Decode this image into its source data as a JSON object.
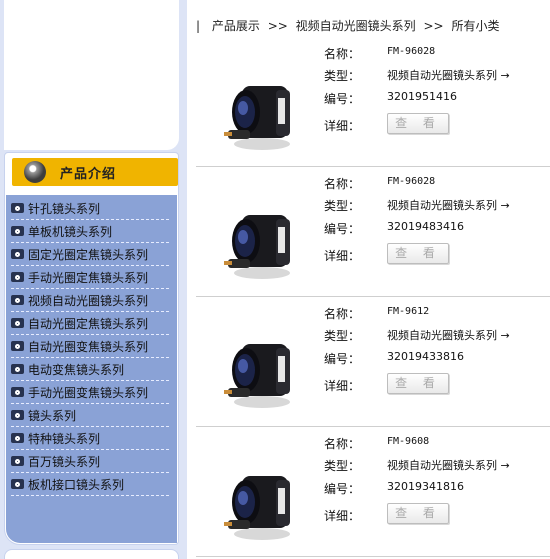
{
  "sidebar": {
    "category_title": "产品介绍",
    "items": [
      {
        "label": "针孔镜头系列"
      },
      {
        "label": "单板机镜头系列"
      },
      {
        "label": "固定光圈定焦镜头系列"
      },
      {
        "label": "手动光圈定焦镜头系列"
      },
      {
        "label": "视频自动光圈镜头系列"
      },
      {
        "label": "自动光圈定焦镜头系列"
      },
      {
        "label": "自动光圈变焦镜头系列"
      },
      {
        "label": "电动变焦镜头系列"
      },
      {
        "label": "手动光圈变焦镜头系列"
      },
      {
        "label": "镜头系列"
      },
      {
        "label": "特种镜头系列"
      },
      {
        "label": "百万镜头系列"
      },
      {
        "label": "板机接口镜头系列"
      }
    ]
  },
  "breadcrumb": {
    "lead": "|",
    "items": [
      "产品展示",
      "视频自动光圈镜头系列",
      "所有小类"
    ],
    "separator": ">>"
  },
  "labels": {
    "name": "名称：",
    "type": "类型：",
    "code": "编号：",
    "detail": "详细：",
    "detail_button": "查 看"
  },
  "products": [
    {
      "name": "FM-96028",
      "type": "视频自动光圈镜头系列 →",
      "code": "3201951416"
    },
    {
      "name": "FM-96028",
      "type": "视频自动光圈镜头系列 →",
      "code": "32019483416"
    },
    {
      "name": "FM-9612",
      "type": "视频自动光圈镜头系列 →",
      "code": "32019433816"
    },
    {
      "name": "FM-9608",
      "type": "视频自动光圈镜头系列 →",
      "code": "32019341816"
    }
  ],
  "colors": {
    "sidebar_bg": "#dde4f6",
    "menu_bg": "#8aa2d6",
    "category_header": "#f0b400"
  }
}
